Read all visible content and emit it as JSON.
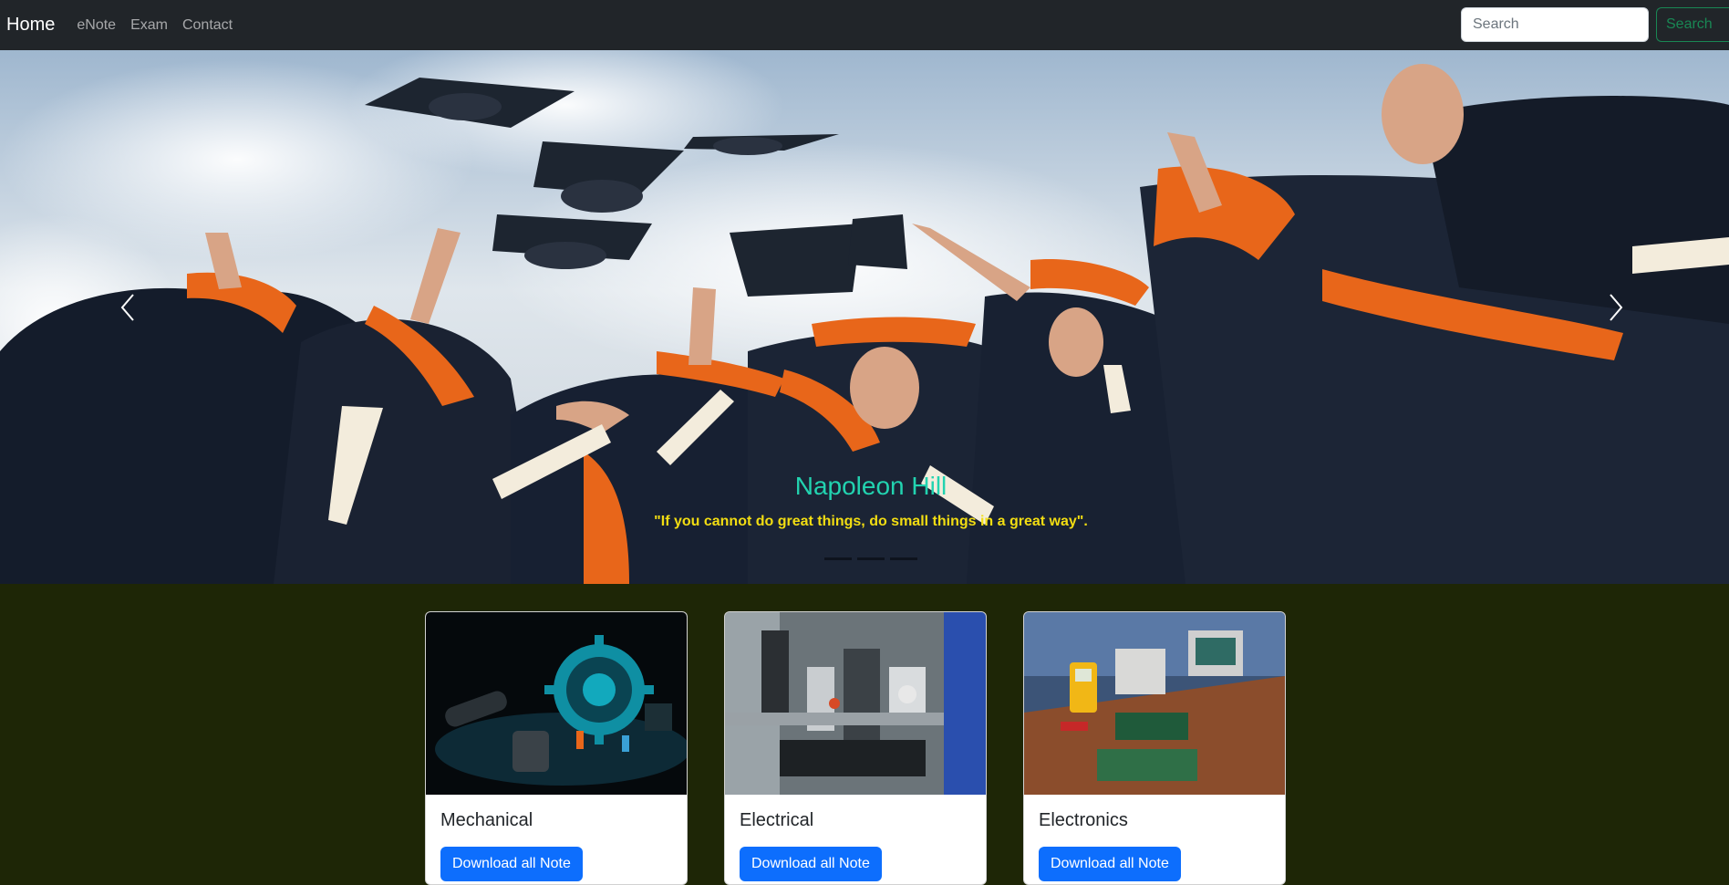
{
  "navbar": {
    "brand": "Home",
    "links": [
      "eNote",
      "Exam",
      "Contact"
    ],
    "search_placeholder": "Search",
    "search_button": "Search"
  },
  "carousel": {
    "caption_title": "Napoleon Hill",
    "caption_quote": "\"If you cannot do great things, do small things in a great way\".",
    "slide_count": 3,
    "active_slide": 1
  },
  "cards": [
    {
      "title": "Mechanical",
      "button": "Download all Note"
    },
    {
      "title": "Electrical",
      "button": "Download all Note"
    },
    {
      "title": "Electronics",
      "button": "Download all Note"
    }
  ],
  "colors": {
    "navbar_bg": "#212529",
    "page_bg": "#1e2606",
    "caption_title": "#22d3b0",
    "caption_quote": "#f2dd12",
    "primary": "#0d6efd",
    "success": "#198754"
  }
}
